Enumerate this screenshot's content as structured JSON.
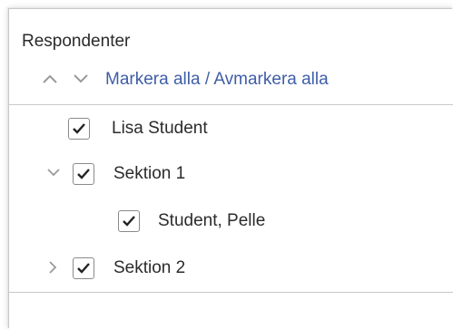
{
  "panel": {
    "title": "Respondenter",
    "toggles": {
      "expand_all_icon": "chevron-up-icon",
      "collapse_all_icon": "chevron-down-icon",
      "select_all_label": "Markera alla / Avmarkera alla"
    },
    "tree": [
      {
        "label": "Lisa Student",
        "checked": true,
        "level": 1
      },
      {
        "label": "Sektion 1",
        "checked": true,
        "level": 0,
        "expanded": true,
        "chevron": "chevron-down-icon"
      },
      {
        "label": "Student, Pelle",
        "checked": true,
        "level": 2
      },
      {
        "label": "Sektion 2",
        "checked": true,
        "level": 0,
        "expanded": false,
        "chevron": "chevron-right-icon"
      }
    ]
  },
  "colors": {
    "link": "#3f5ea8",
    "text": "#2b2b2b",
    "chevron": "#9a9a9a",
    "checkbox_border": "#8a8a8a",
    "divider": "#c9c9c9"
  }
}
